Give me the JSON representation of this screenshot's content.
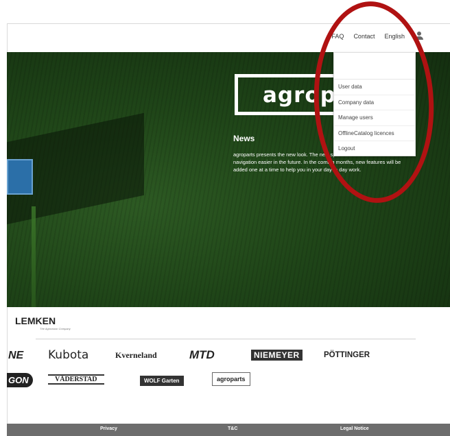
{
  "nav": {
    "faq": "FAQ",
    "contact": "Contact",
    "language": "English"
  },
  "hero": {
    "logo_text": "agroparts",
    "news_title": "News",
    "news_text": "agroparts presents the new look. The new specific dashboards will make navigation easier in the future. In the coming months, new features will be added one at a time to help you in your day to day work."
  },
  "user_menu": {
    "items": [
      {
        "label": "User data"
      },
      {
        "label": "Company data"
      },
      {
        "label": "Manage users"
      },
      {
        "label": "OfflineCatalog licences"
      },
      {
        "label": "Logout"
      }
    ]
  },
  "brands": {
    "lemken": "LEMKEN",
    "lemken_tagline": "The Agrovision Company",
    "row1": [
      "NE",
      "Kubota",
      "Kverneland",
      "MTD",
      "NIEMEYER",
      "PÖTTINGER"
    ],
    "row2": [
      "GON",
      "VÄDERSTAD",
      "WOLF Garten",
      "agroparts"
    ]
  },
  "footer": {
    "privacy": "Privacy",
    "tc": "T&C",
    "legal": "Legal Notice"
  },
  "colors": {
    "annotation": "#b01212",
    "footer": "#6d6d6d",
    "field_green": "#1f4518"
  }
}
